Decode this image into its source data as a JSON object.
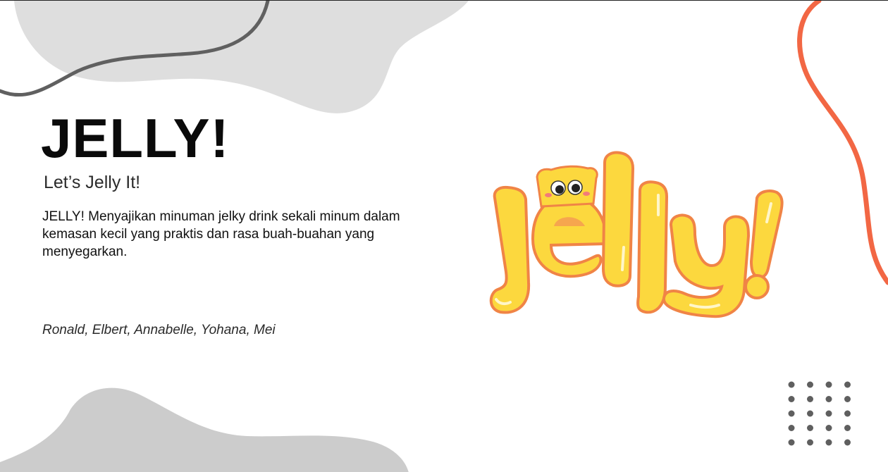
{
  "slide": {
    "title": "JELLY!",
    "tagline": "Let’s Jelly It!",
    "description": "JELLY! Menyajikan minuman jelky drink sekali minum dalam kemasan kecil yang praktis dan rasa buah-buahan yang menyegarkan.",
    "authors": "Ronald, Elbert, Annabelle, Yohana, Mei"
  },
  "logo": {
    "wordmark": "jelly!",
    "mascot": "yellow-jelly-cube-mascot"
  },
  "colors": {
    "blob_gray": "#dedede",
    "blob_gray_bottom": "#cccccc",
    "dark_curve": "#606060",
    "accent_curve": "#f26744",
    "logo_fill": "#fcd83e",
    "logo_outline": "#f08446",
    "dots": "#5f5f5f"
  }
}
